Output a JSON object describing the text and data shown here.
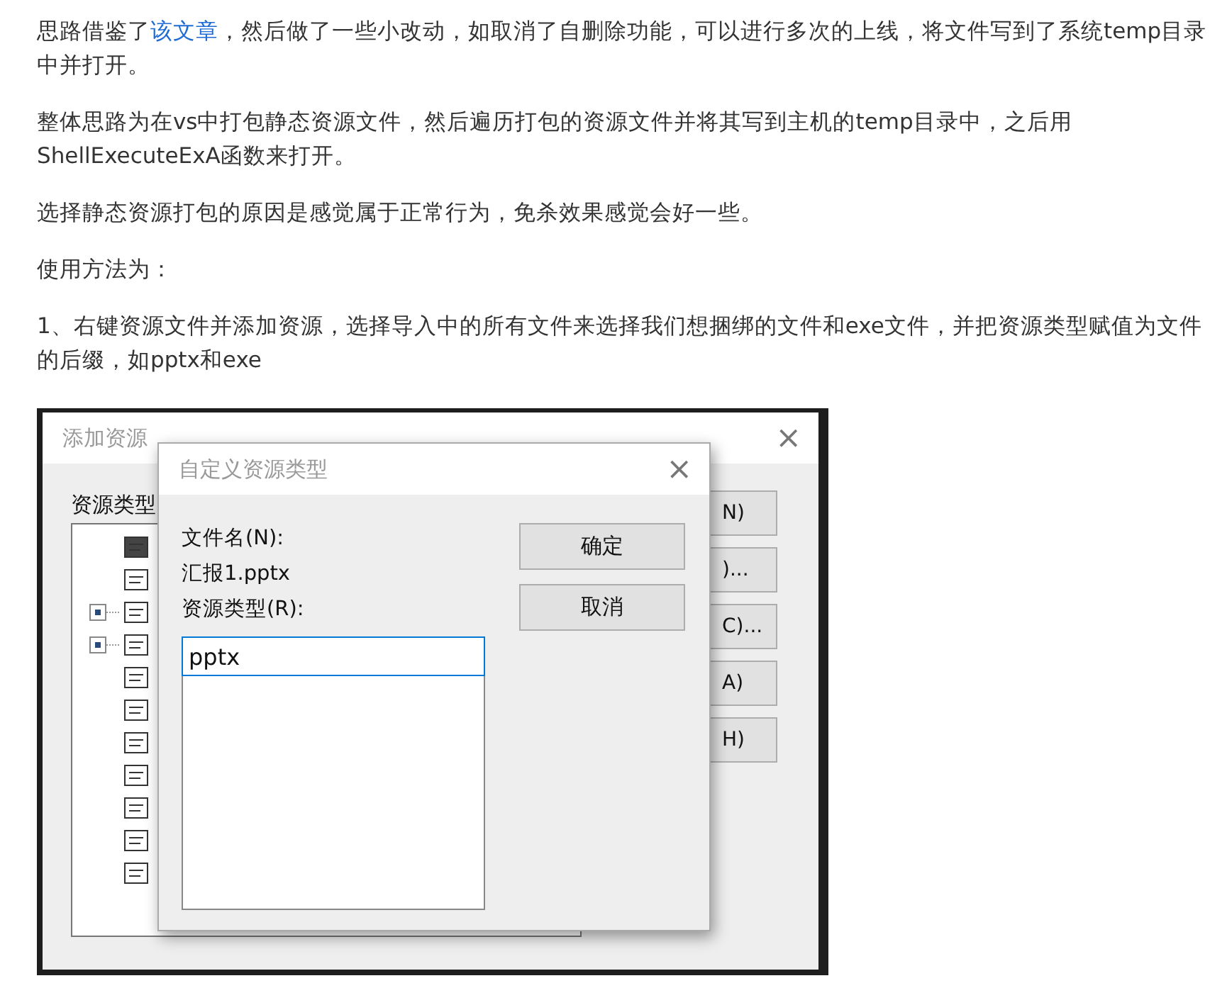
{
  "paragraphs": [
    {
      "lines": [
        [
          {
            "kind": "text",
            "text": "思路借鉴了"
          },
          {
            "kind": "link",
            "text": "该文章"
          },
          {
            "kind": "text",
            "text": "，然后做了一些小改动，如取消了自删除功能，可以进行多次的上线，将文件写到了系统temp目录"
          }
        ],
        [
          {
            "kind": "text",
            "text": "中并打开。"
          }
        ]
      ]
    },
    {
      "lines": [
        [
          {
            "kind": "text",
            "text": "整体思路为在vs中打包静态资源文件，然后遍历打包的资源文件并将其写到主机的temp目录中，之后用"
          }
        ],
        [
          {
            "kind": "text",
            "text": "ShellExecuteExA函数来打开。"
          }
        ]
      ]
    },
    {
      "lines": [
        [
          {
            "kind": "text",
            "text": "选择静态资源打包的原因是感觉属于正常行为，免杀效果感觉会好一些。"
          }
        ]
      ]
    },
    {
      "lines": [
        [
          {
            "kind": "text",
            "text": "使用方法为："
          }
        ]
      ]
    },
    {
      "lines": [
        [
          {
            "kind": "text",
            "text": "1、右键资源文件并添加资源，选择导入中的所有文件来选择我们想捆绑的文件和exe文件，并把资源类型赋值为文件"
          }
        ],
        [
          {
            "kind": "text",
            "text": "的后缀，如pptx和exe"
          }
        ]
      ]
    }
  ],
  "screenshot": {
    "back_dialog": {
      "title": "添加资源",
      "close": "×",
      "tree_label": "资源类型",
      "tree": [
        {
          "expandable": false
        },
        {
          "expandable": false
        },
        {
          "expandable": true
        },
        {
          "expandable": true
        },
        {
          "expandable": false
        },
        {
          "expandable": false
        },
        {
          "expandable": false
        },
        {
          "expandable": false
        },
        {
          "expandable": false
        },
        {
          "expandable": false
        },
        {
          "expandable": false
        }
      ],
      "buttons": [
        "N)",
        ")...",
        "C)...",
        "A)",
        "H)"
      ]
    },
    "front_dialog": {
      "title": "自定义资源类型",
      "close": "×",
      "file_label": "文件名(N):",
      "file_name": "汇报1.pptx",
      "type_label": "资源类型(R):",
      "type_value": "pptx",
      "buttons": [
        "确定",
        "取消"
      ]
    }
  }
}
